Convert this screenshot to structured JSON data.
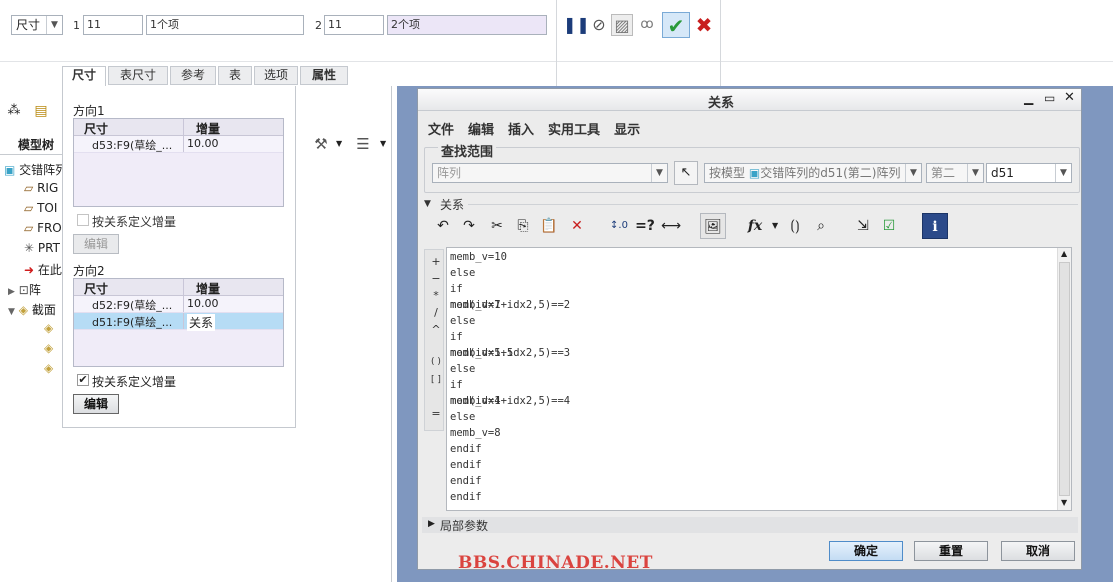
{
  "top_bar": {
    "type_select": "尺寸",
    "dir1_num": "1",
    "dir1_count": "11",
    "dir1_items": "1个项",
    "dir2_num": "2",
    "dir2_count": "11",
    "dir2_items": "2个项"
  },
  "tabs": [
    "尺寸",
    "表尺寸",
    "参考",
    "表",
    "选项",
    "属性"
  ],
  "dim_panel": {
    "dir1_title": "方向1",
    "dir1_headers": [
      "尺寸",
      "增量"
    ],
    "dir1_rows": [
      {
        "dim": "d53:F9(草绘_...",
        "inc": "10.00"
      }
    ],
    "dir1_checkbox": "按关系定义增量",
    "dir1_edit": "编辑",
    "dir2_title": "方向2",
    "dir2_headers": [
      "尺寸",
      "增量"
    ],
    "dir2_rows": [
      {
        "dim": "d52:F9(草绘_...",
        "inc": "10.00"
      },
      {
        "dim": "d51:F9(草绘_...",
        "inc": "关系"
      }
    ],
    "dir2_checkbox": "按关系定义增量",
    "dir2_edit": "编辑"
  },
  "model_tree": {
    "title": "模型树",
    "items": [
      "交错阵列",
      "RIG",
      "TOI",
      "FRO",
      "PRT",
      "在此",
      "阵",
      "截面"
    ]
  },
  "dialog": {
    "title": "关系",
    "menu": [
      "文件",
      "编辑",
      "插入",
      "实用工具",
      "显示"
    ],
    "scope_label": "查找范围",
    "scope_type": "阵列",
    "scope_model": "按模型",
    "scope_target": "交错阵列的d51(第二)阵列",
    "scope_second": "第二",
    "scope_dim": "d51",
    "relations_label": "关系",
    "side_ops": [
      "+",
      "−",
      "*",
      "/",
      "^",
      "( )",
      "[ ]",
      "="
    ],
    "code_lines": [
      "memb_v=10",
      "else",
      "if mod(idx1+idx2,5)==2",
      "memb_v=7",
      "else",
      "if mod(idx1+idx2,5)==3",
      "memb_v=5.5",
      "else",
      "if mod(idx1+idx2,5)==4",
      "memb_v=4",
      "else",
      "memb_v=8",
      "endif",
      "endif",
      "endif",
      "endif"
    ],
    "local_params": "局部参数",
    "ok": "确定",
    "reset": "重置",
    "cancel": "取消"
  },
  "watermark": "BBS.CHINADE.NET",
  "colors": {
    "accent": "#1f6fd1",
    "check": "#2a9a3a",
    "cross": "#c81e1e",
    "watermark": "#d9322d"
  }
}
